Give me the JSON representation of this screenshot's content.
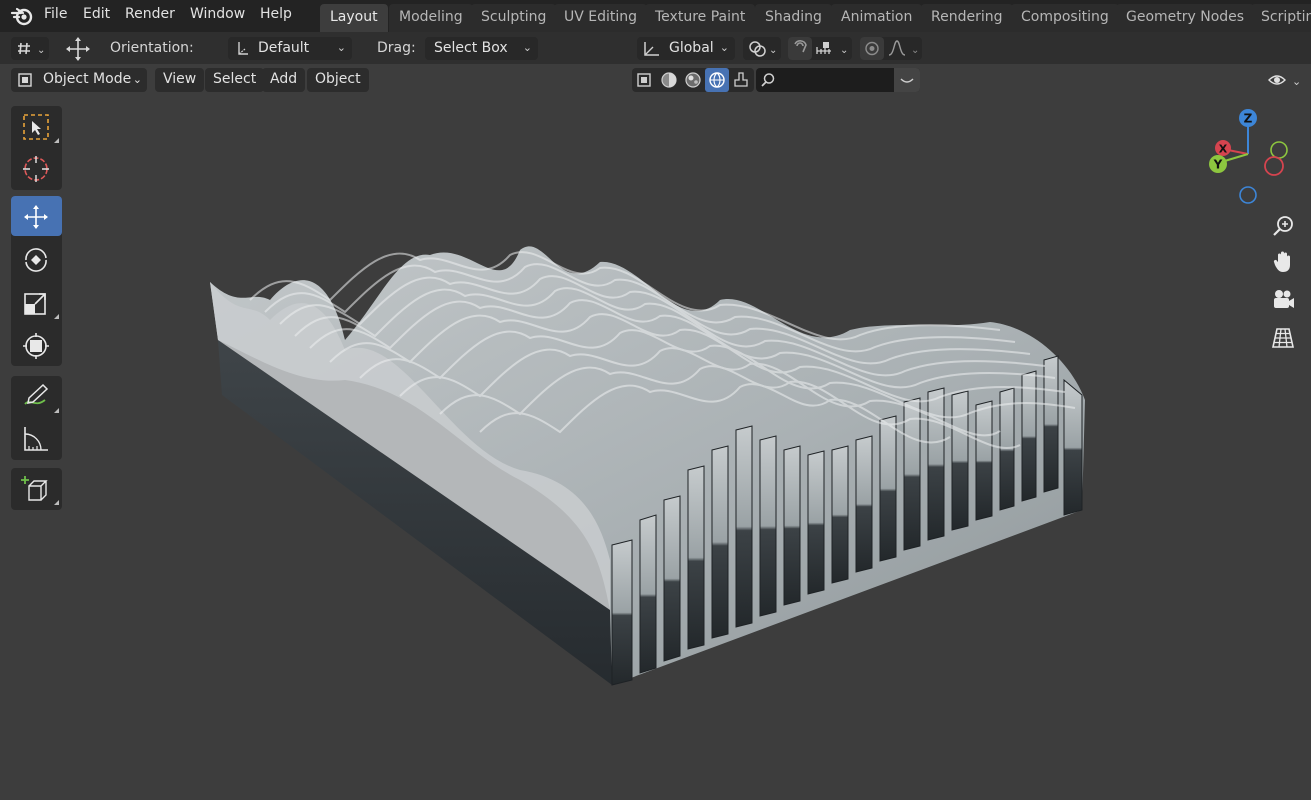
{
  "menu": {
    "items": [
      "File",
      "Edit",
      "Render",
      "Window",
      "Help"
    ]
  },
  "workspaces": {
    "tabs": [
      "Layout",
      "Modeling",
      "Sculpting",
      "UV Editing",
      "Texture Paint",
      "Shading",
      "Animation",
      "Rendering",
      "Compositing",
      "Geometry Nodes",
      "Scripting"
    ],
    "active": "Layout"
  },
  "tool_header": {
    "orientation_label": "Orientation:",
    "orientation_value": "Default",
    "drag_label": "Drag:",
    "drag_value": "Select Box",
    "transform_orientation": "Global"
  },
  "view_header": {
    "mode": "Object Mode",
    "menus": [
      "View",
      "Select",
      "Add",
      "Object"
    ],
    "active_shading": "material-preview",
    "search_placeholder": ""
  },
  "toolbar": {
    "tools": [
      "select-box",
      "cursor",
      "move",
      "rotate",
      "scale",
      "transform",
      "annotate",
      "measure",
      "add-cube"
    ],
    "active_tool": "move"
  },
  "gizmo": {
    "axes": {
      "x": "X",
      "y": "Y",
      "z": "Z"
    },
    "colors": {
      "x": "#d5444f",
      "y": "#8dc63f",
      "z": "#3d86d8"
    }
  },
  "nav_buttons": [
    "zoom-icon",
    "hand-icon",
    "camera-icon",
    "grid-icon"
  ],
  "colors": {
    "accent": "#4772b3",
    "viewport_bg": "#3d3d3d",
    "header_bg": "#232323"
  }
}
